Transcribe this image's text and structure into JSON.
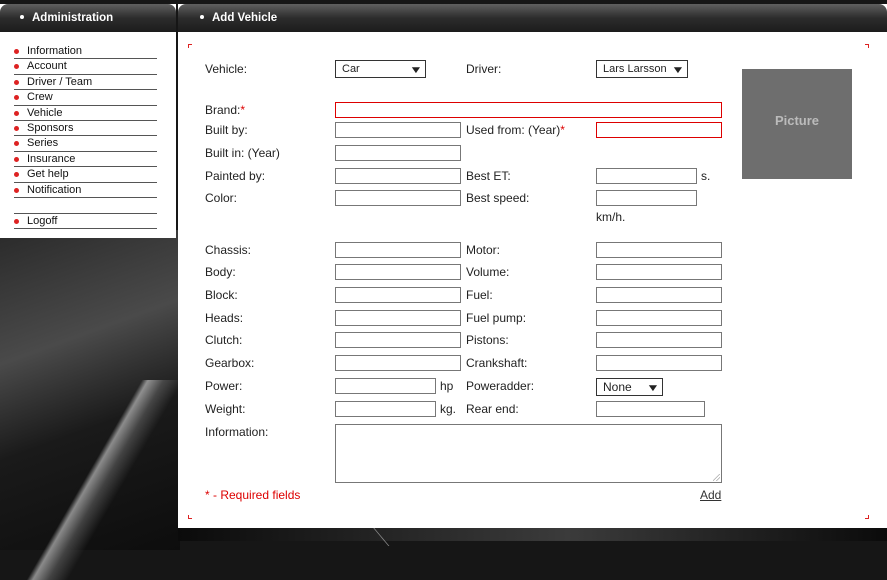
{
  "sidebar": {
    "title": "Administration",
    "items": [
      "Information",
      "Account",
      "Driver / Team",
      "Crew",
      "Vehicle",
      "Sponsors",
      "Series",
      "Insurance",
      "Get help",
      "Notification"
    ],
    "logoff": "Logoff"
  },
  "form": {
    "title": "Add  Vehicle",
    "picture_label": "Picture",
    "required_note": "* - Required fields",
    "add_label": "Add",
    "labels": {
      "vehicle": "Vehicle:",
      "driver": "Driver:",
      "brand": "Brand:",
      "built_by": "Built by:",
      "used_from": "Used from: (Year)",
      "built_in": "Built in: (Year)",
      "painted_by": "Painted by:",
      "best_et": "Best ET:",
      "color": "Color:",
      "best_speed": "Best speed:",
      "chassis": "Chassis:",
      "motor": "Motor:",
      "body": "Body:",
      "volume": "Volume:",
      "block": "Block:",
      "fuel": "Fuel:",
      "heads": "Heads:",
      "fuel_pump": "Fuel pump:",
      "clutch": "Clutch:",
      "pistons": "Pistons:",
      "gearbox": "Gearbox:",
      "crankshaft": "Crankshaft:",
      "power": "Power:",
      "poweradder": "Poweradder:",
      "weight": "Weight:",
      "rear_end": "Rear end:",
      "information": "Information:"
    },
    "required_mark": "*",
    "units": {
      "seconds": "s.",
      "speed": "km/h.",
      "power": "hp",
      "weight": "kg."
    },
    "selects": {
      "vehicle": "Car",
      "driver": "Lars Larsson",
      "poweradder": "None"
    }
  }
}
